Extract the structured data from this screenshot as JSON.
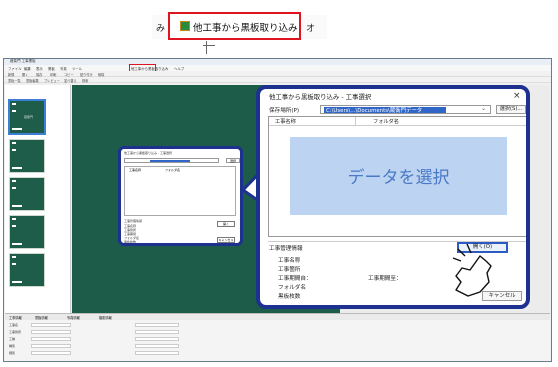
{
  "callout": {
    "left_fragment": "み",
    "label": "他工事から黒板取り込み",
    "right_fragment": "オ"
  },
  "app": {
    "title": "蔵衛門 工事黒板",
    "menu": [
      "ファイル",
      "編集",
      "表示",
      "黒板",
      "写真",
      "ツール",
      "他工事から黒板取り込み",
      "ヘルプ"
    ],
    "toolbar1": [
      "新規",
      "開く",
      "保存",
      "印刷",
      "コピー",
      "貼り付け",
      "削除"
    ],
    "toolbar2": [
      "黒板一覧",
      "黒板編集",
      "プレビュー",
      "並べ替え",
      "検索"
    ],
    "thumb_word": "蔵衛門"
  },
  "small_dialog": {
    "title": "他工事から黒板取り込み - 工事選択",
    "select": "選択",
    "col1": "工事名称",
    "col2": "フォルダ名",
    "info": [
      "工事管理情報",
      "工事名称",
      "工事箇所",
      "工事期間",
      "フォルダ名",
      "黒板枚数"
    ],
    "open": "開く",
    "cancel": "キャンセル"
  },
  "bottom": {
    "tabs": [
      "工事情報",
      "黒板情報",
      "写真情報",
      "撮影情報"
    ],
    "rows": [
      "工事名",
      "工事箇所",
      "工種",
      "種別",
      "細別"
    ]
  },
  "dialog": {
    "title": "他工事から黒板取り込み - 工事選択",
    "close": "×",
    "path_label": "保存場所(P)",
    "path_value": "C:\\Users\\...\\Documents\\蔵衛門データ",
    "select_button": "選択(S)...",
    "col_name": "工事名称",
    "col_folder": "フォルダ名",
    "placeholder": "データを選択",
    "info_title": "工事管理情報",
    "fields": [
      "工事名称",
      "工事箇所",
      "工事期間自：",
      "フォルダ名",
      "黒板枚数"
    ],
    "period_end": "工事期間至：",
    "open_button": "開く(O)",
    "cancel_button": "キャンセル"
  },
  "colors": {
    "accent_red": "#e0141e",
    "dialog_border": "#1d3190",
    "board_green": "#1c5c49",
    "placeholder_bg": "#bcd3f1",
    "placeholder_text": "#4a79c7"
  }
}
